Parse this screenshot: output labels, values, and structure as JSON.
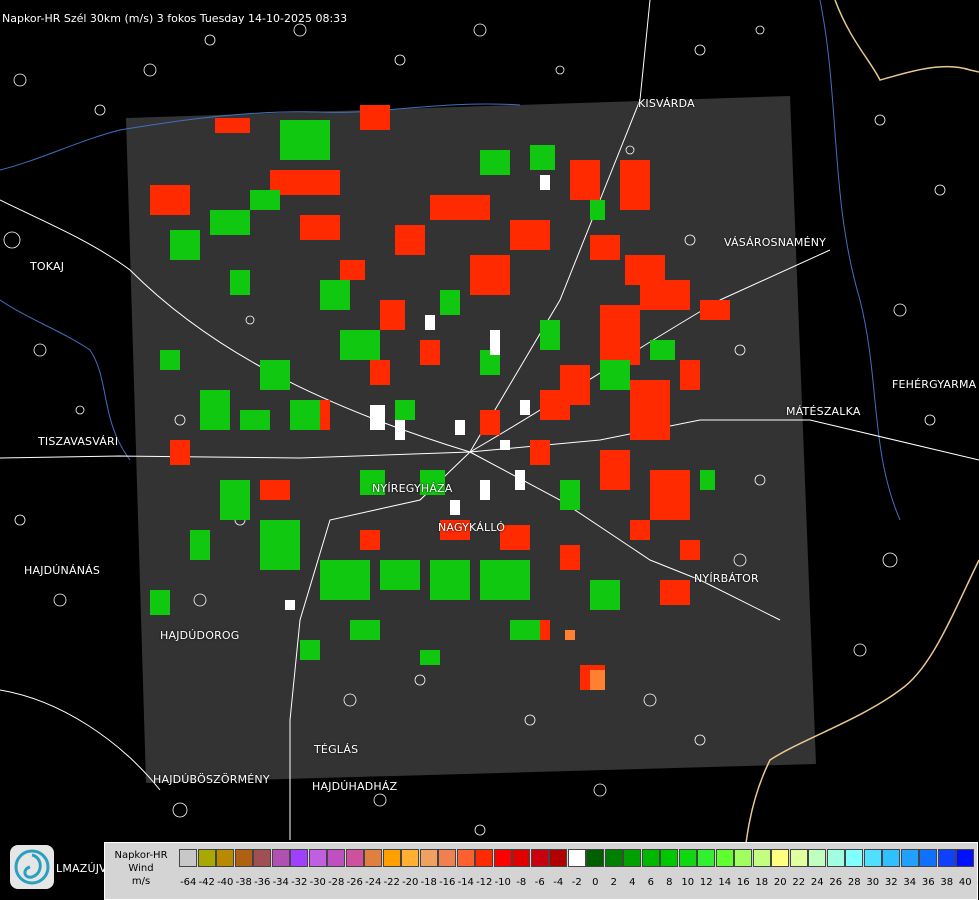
{
  "header": {
    "title": "Napkor-HR Szél 30km (m/s) 3 fokos Tuesday 14-10-2025 08:33"
  },
  "cities": [
    {
      "name": "KISVÁRDA"
    },
    {
      "name": "TOKAJ"
    },
    {
      "name": "VÁSÁROSNAMÉNY"
    },
    {
      "name": "FEHÉRGYARMA"
    },
    {
      "name": "MÁTÉSZALKA"
    },
    {
      "name": "TISZAVASVÁRI"
    },
    {
      "name": "NYÍREGYHÁZA"
    },
    {
      "name": "NAGYKÁLLÓ"
    },
    {
      "name": "HAJDÚNÁNÁS"
    },
    {
      "name": "NYÍRBÁTOR"
    },
    {
      "name": "HAJDÚDOROG"
    },
    {
      "name": "TÉGLÁS"
    },
    {
      "name": "HAJDÚBÖSZÖRMÉNY"
    },
    {
      "name": "HAJDÚHADHÁZ"
    },
    {
      "name": "LMAZÚJVÁR"
    }
  ],
  "legend": {
    "title_line1": "Napkor-HR",
    "title_line2": "Wind",
    "title_line3": "m/s",
    "ticks": [
      "-64",
      "-42",
      "-40",
      "-38",
      "-36",
      "-34",
      "-32",
      "-30",
      "-28",
      "-26",
      "-24",
      "-22",
      "-20",
      "-18",
      "-16",
      "-14",
      "-12",
      "-10",
      "-8",
      "-6",
      "-4",
      "-2",
      "0",
      "2",
      "4",
      "6",
      "8",
      "10",
      "12",
      "14",
      "16",
      "18",
      "20",
      "22",
      "24",
      "26",
      "28",
      "30",
      "32",
      "34",
      "36",
      "38",
      "40",
      "42"
    ],
    "colors": [
      "#c8c8c8",
      "#a8a800",
      "#b88a00",
      "#b06010",
      "#a05050",
      "#b050b0",
      "#a040ff",
      "#c060e0",
      "#c050c0",
      "#d050a0",
      "#e08040",
      "#ffa000",
      "#ffb030",
      "#f0a060",
      "#f08050",
      "#ff6030",
      "#ff2a00",
      "#ff0000",
      "#e00000",
      "#c80010",
      "#b00000",
      "#ffffff",
      "#006000",
      "#008000",
      "#00a000",
      "#00b800",
      "#00c800",
      "#10d810",
      "#30f030",
      "#60ff30",
      "#a0ff60",
      "#c0ff80",
      "#ffff80",
      "#e0ffa0",
      "#c0ffc0",
      "#a0ffe0",
      "#80ffff",
      "#50e0ff",
      "#30c0ff",
      "#20a0ff",
      "#1070ff",
      "#1040ff",
      "#0010ff"
    ]
  }
}
